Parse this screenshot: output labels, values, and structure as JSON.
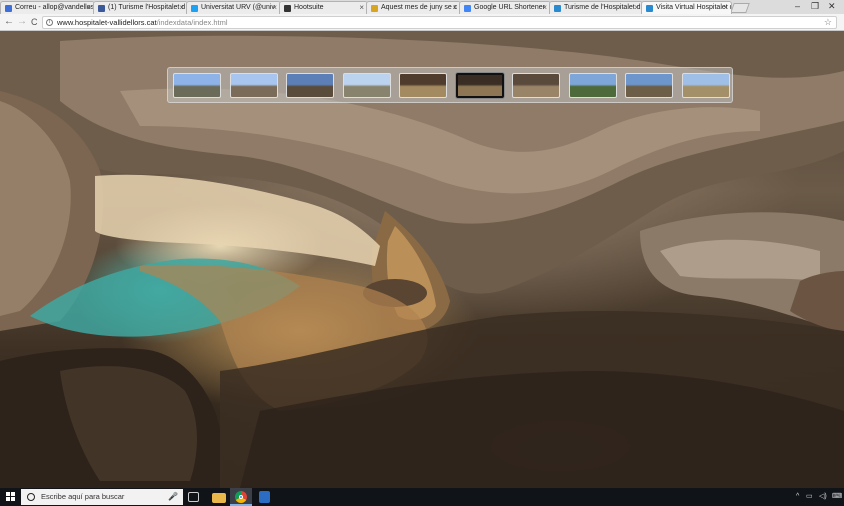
{
  "browser": {
    "tabs": [
      {
        "title": "Correu - allop@vandellos",
        "favicon_color": "#3d6fd9",
        "active": false
      },
      {
        "title": "(1) Turisme l'Hospitalet d",
        "favicon_color": "#3b5998",
        "active": false
      },
      {
        "title": "Universitat URV (@univ",
        "favicon_color": "#1da1f2",
        "active": false
      },
      {
        "title": "Hootsuite",
        "favicon_color": "#333333",
        "active": false
      },
      {
        "title": "Aquest mes de juny se c",
        "favicon_color": "#d9a520",
        "active": false
      },
      {
        "title": "Google URL Shortener",
        "favicon_color": "#4285f4",
        "active": false
      },
      {
        "title": "Turisme de l'Hospitalet d",
        "favicon_color": "#2a8ad0",
        "active": false
      },
      {
        "title": "Visita Virtual Hospitalet d",
        "favicon_color": "#2a8ad0",
        "active": true
      }
    ],
    "window_controls": {
      "minimize": "–",
      "restore": "❐",
      "close": "✕"
    },
    "nav": {
      "back": "←",
      "forward": "→",
      "reload": "C"
    },
    "address": {
      "domain": "www.hospitalet-vallidellors.cat",
      "path": "/indexdata/index.html",
      "info_icon": "i"
    },
    "star": "☆"
  },
  "viewer": {
    "thumbnails": [
      {
        "name": "panorama-1",
        "sky": "#8db3e8",
        "ground": "#6b6b5a",
        "active": false
      },
      {
        "name": "panorama-2",
        "sky": "#a7c5ee",
        "ground": "#7a6c58",
        "active": false
      },
      {
        "name": "panorama-3",
        "sky": "#5d7fb8",
        "ground": "#5a4c3b",
        "active": false
      },
      {
        "name": "panorama-4",
        "sky": "#bcd3f0",
        "ground": "#87836d",
        "active": false
      },
      {
        "name": "panorama-5",
        "sky": "#4f3c2c",
        "ground": "#a48a60",
        "active": false
      },
      {
        "name": "panorama-6",
        "sky": "#3a2e24",
        "ground": "#8e7654",
        "active": true
      },
      {
        "name": "panorama-7",
        "sky": "#5a4a3c",
        "ground": "#9a8468",
        "active": false
      },
      {
        "name": "panorama-8",
        "sky": "#7ea6d8",
        "ground": "#4d6b3a",
        "active": false
      },
      {
        "name": "panorama-9",
        "sky": "#6d97cc",
        "ground": "#6d5e48",
        "active": false
      },
      {
        "name": "panorama-10",
        "sky": "#9fbfe6",
        "ground": "#a39068",
        "active": false
      }
    ],
    "controls": [
      {
        "name": "zoom-in-icon",
        "glyph": "⊕"
      },
      {
        "name": "zoom-out-icon",
        "glyph": "⊖"
      },
      {
        "name": "screen-mode-icon",
        "glyph": "▭"
      },
      {
        "name": "autorotate-icon",
        "glyph": "↻"
      },
      {
        "name": "fullscreen-icon",
        "glyph": "⛶"
      },
      {
        "name": "window-icon",
        "glyph": "▬"
      }
    ]
  },
  "taskbar": {
    "search_placeholder": "Escribe aquí para buscar",
    "mic": "🎤",
    "tray": {
      "chevron": "^",
      "network": "▭",
      "volume": "◁)",
      "keyboard": "⌨"
    }
  }
}
